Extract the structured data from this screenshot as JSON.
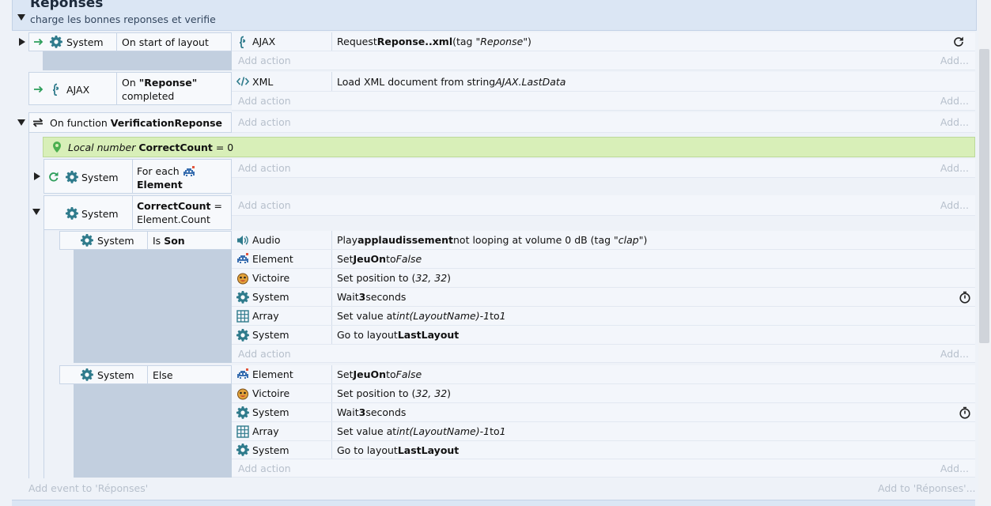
{
  "group": {
    "title": "Reponses",
    "description": "charge les bonnes reponses et verifie"
  },
  "events": {
    "e1": {
      "object": "System",
      "condition": "On start of layout",
      "action": {
        "object": "AJAX",
        "pre": "Request ",
        "bold": "Reponse..xml",
        "mid": " (tag \"",
        "ital": "Reponse",
        "post": "\")"
      }
    },
    "e2": {
      "object": "AJAX",
      "cond_pre": "On ",
      "cond_bold": "\"Reponse\"",
      "cond_post": "completed",
      "action": {
        "object": "XML",
        "pre": "Load XML document from string ",
        "ital": "AJAX.LastData"
      }
    },
    "e3": {
      "pre": "On function ",
      "bold": "VerificationReponse"
    },
    "local_var": {
      "pre": "Local number ",
      "bold": "CorrectCount",
      "post": " = 0"
    },
    "e4": {
      "object": "System",
      "cond_pre": "For each ",
      "cond_bold": "Element"
    },
    "e5": {
      "object": "System",
      "cond_bold": "CorrectCount",
      "cond_pre": " =",
      "cond_post": "Element.Count"
    },
    "e6": {
      "object": "System",
      "cond_pre": "Is ",
      "cond_bold": "Son",
      "actions": [
        {
          "object": "Audio",
          "pre": "Play ",
          "bold": "applaudissement",
          "mid": " not looping at volume 0 dB (tag \"",
          "ital": "clap",
          "post": "\")"
        },
        {
          "object": "Element",
          "pre": "Set ",
          "bold": "JeuOn",
          "mid": " to ",
          "ital": "False"
        },
        {
          "object": "Victoire",
          "pre": "Set position to (",
          "ital": "32, 32",
          "post": ")"
        },
        {
          "object": "System",
          "pre": "Wait ",
          "bold": "3",
          "post": " seconds"
        },
        {
          "object": "Array",
          "pre": "Set value at ",
          "ital": "int(LayoutName)-1",
          "mid": " to ",
          "ital2": "1"
        },
        {
          "object": "System",
          "pre": "Go to layout ",
          "bold": "LastLayout"
        }
      ]
    },
    "e7": {
      "object": "System",
      "condition": "Else",
      "actions": [
        {
          "object": "Element",
          "pre": "Set ",
          "bold": "JeuOn",
          "mid": " to ",
          "ital": "False"
        },
        {
          "object": "Victoire",
          "pre": "Set position to (",
          "ital": "32, 32",
          "post": ")"
        },
        {
          "object": "System",
          "pre": "Wait ",
          "bold": "3",
          "post": " seconds"
        },
        {
          "object": "Array",
          "pre": "Set value at ",
          "ital": "int(LayoutName)-1",
          "mid": " to ",
          "ital2": "1"
        },
        {
          "object": "System",
          "pre": "Go to layout ",
          "bold": "LastLayout"
        }
      ]
    }
  },
  "labels": {
    "add_action": "Add action",
    "add_right": "Add...",
    "add_event": "Add event to 'Réponses'",
    "add_to": "Add to 'Réponses'..."
  },
  "colors": {
    "accent": "#2e7d6f",
    "local_var_bg": "#d8efb8",
    "strip": "#c2cfdf"
  },
  "icons": {
    "system": "gear-icon",
    "ajax": "ajax-icon",
    "xml": "code-icon",
    "audio": "speaker-icon",
    "element": "sprite-icon",
    "victoire": "face-icon",
    "array": "grid-icon",
    "timer": "stopwatch-icon",
    "refresh": "refresh-icon"
  }
}
